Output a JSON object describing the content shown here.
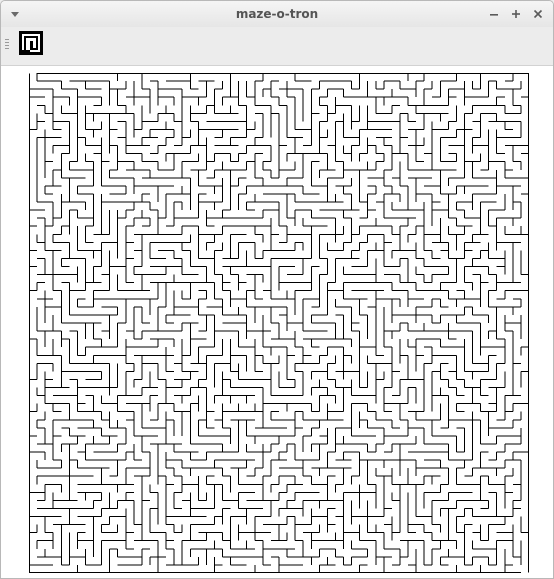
{
  "window": {
    "title": "maze-o-tron"
  },
  "icons": {
    "window_menu": "chevron-down-icon",
    "minimize": "minimize-icon",
    "maximize": "maximize-icon",
    "close": "close-icon",
    "toolbar_grip": "grip-icon",
    "app_logo": "maze-logo-icon"
  },
  "maze": {
    "columns": 62,
    "rows": 62,
    "wall_color": "#000000",
    "background_color": "#ffffff"
  }
}
